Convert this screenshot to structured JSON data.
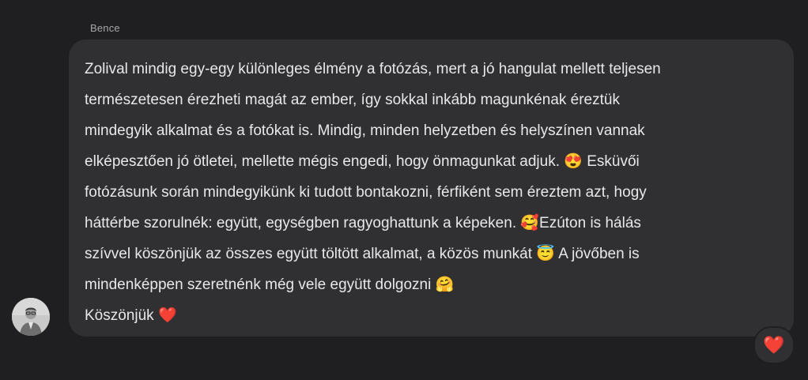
{
  "message": {
    "sender": "Bence",
    "lines": [
      "Zolival mindig egy-egy különleges élmény a fotózás, mert a jó hangulat mellett teljesen",
      "természetesen érezheti magát az ember, így sokkal inkább magunkénak éreztük",
      "mindegyik alkalmat és a fotókat is. Mindig, minden helyzetben és helyszínen vannak",
      "elképesztően jó ötletei, mellette mégis engedi, hogy önmagunkat adjuk. 😍 Esküvői",
      "fotózásunk során mindegyikünk ki tudott bontakozni, férfiként sem éreztem azt, hogy",
      "háttérbe szorulnék: együtt, egységben ragyoghattunk a képeken. 🥰Ezúton is hálás",
      "szívvel köszönjük az összes együtt töltött alkalmat, a közös munkát 😇 A jövőben is",
      "mindenképpen szeretnénk még vele együtt dolgozni 🤗",
      "Köszönjük ❤️"
    ]
  },
  "reaction": {
    "emoji": "❤️"
  },
  "colors": {
    "background": "#1f1f21",
    "bubble": "#303033",
    "text": "#e8e8ea",
    "sender": "#a6a6aa"
  }
}
